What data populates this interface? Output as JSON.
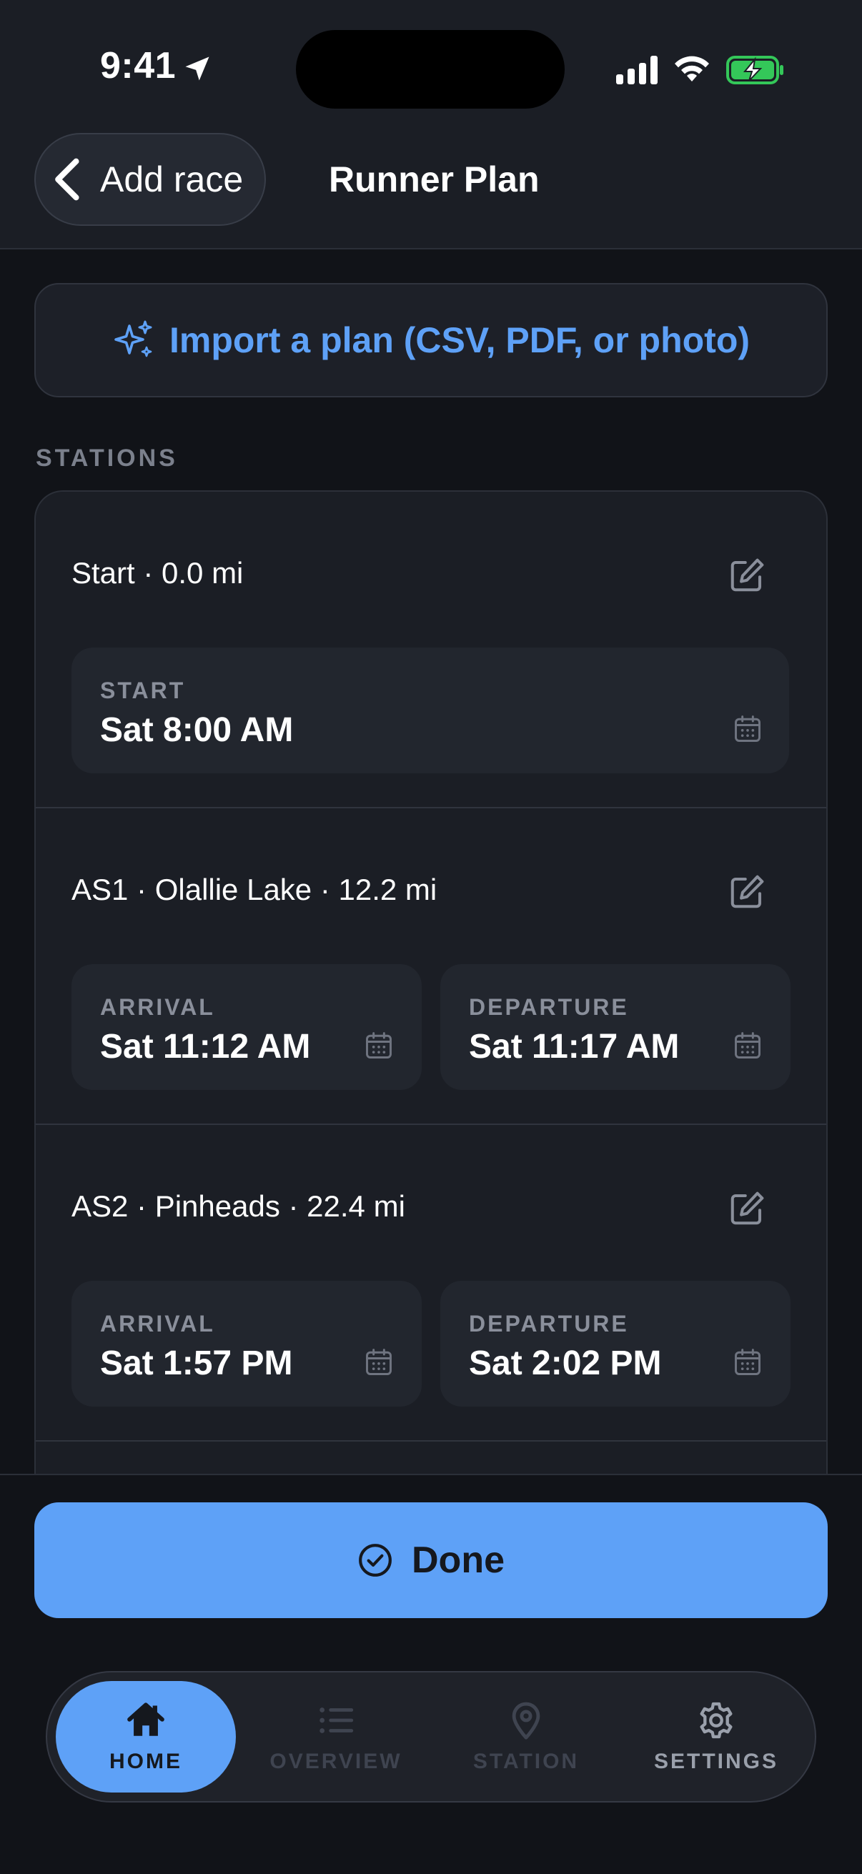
{
  "status_bar": {
    "time": "9:41"
  },
  "header": {
    "back_label": "Add race",
    "title": "Runner Plan"
  },
  "import": {
    "label": "Import a plan (CSV, PDF, or photo)"
  },
  "section_label": "STATIONS",
  "stations": [
    {
      "title": "Start · 0.0 mi",
      "start_label": "START",
      "start_value": "Sat 8:00 AM"
    },
    {
      "title": "AS1 · Olallie Lake · 12.2 mi",
      "arrival_label": "ARRIVAL",
      "arrival_value": "Sat 11:12 AM",
      "departure_label": "DEPARTURE",
      "departure_value": "Sat 11:17 AM"
    },
    {
      "title": "AS2 · Pinheads · 22.4 mi",
      "arrival_label": "ARRIVAL",
      "arrival_value": "Sat 1:57 PM",
      "departure_label": "DEPARTURE",
      "departure_value": "Sat 2:02 PM"
    }
  ],
  "done": {
    "label": "Done"
  },
  "tabs": [
    {
      "label": "HOME",
      "icon": "home-icon",
      "active": true
    },
    {
      "label": "OVERVIEW",
      "icon": "list-icon",
      "active": false
    },
    {
      "label": "STATION",
      "icon": "map-pin-icon",
      "active": false
    },
    {
      "label": "SETTINGS",
      "icon": "gear-icon",
      "active": false
    }
  ],
  "colors": {
    "accent": "#5ea1f7",
    "background": "#111318",
    "surface": "#1b1e25",
    "battery_green": "#34c759"
  }
}
